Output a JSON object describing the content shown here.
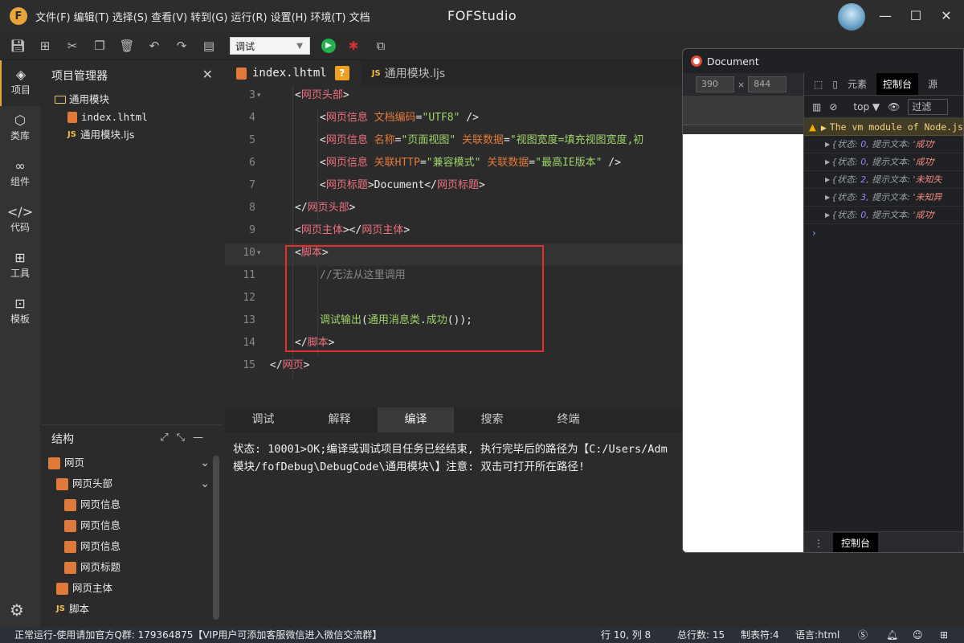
{
  "app": {
    "title": "FOFStudio",
    "logo_letter": "F"
  },
  "menu": [
    "文件(F)",
    "编辑(T)",
    "选择(S)",
    "查看(V)",
    "转到(G)",
    "运行(R)",
    "设置(H)",
    "环境(T)",
    "文档"
  ],
  "toolbar": {
    "mode_value": "调试"
  },
  "activity": [
    {
      "label": "项目",
      "icon": "layers-icon"
    },
    {
      "label": "类库",
      "icon": "cube-icon"
    },
    {
      "label": "组件",
      "icon": "link-icon"
    },
    {
      "label": "代码",
      "icon": "code-icon"
    },
    {
      "label": "工具",
      "icon": "grid-icon"
    },
    {
      "label": "模板",
      "icon": "template-icon"
    }
  ],
  "project": {
    "title": "项目管理器",
    "folder": "通用模块",
    "files": [
      "index.lhtml",
      "通用模块.ljs"
    ]
  },
  "structure": {
    "title": "结构",
    "items": [
      "网页",
      "网页头部",
      "网页信息",
      "网页信息",
      "网页信息",
      "网页标题",
      "网页主体",
      "脚本"
    ]
  },
  "tabs": {
    "active": "index.lhtml",
    "modified_mark": "?",
    "other": "通用模块.ljs",
    "js_badge": "JS"
  },
  "code_lines": [
    {
      "n": "3",
      "parts": [
        [
          "t-txt",
          "<"
        ],
        [
          "t-tag",
          "网页头部"
        ],
        [
          "t-txt",
          ">"
        ]
      ]
    },
    {
      "n": "4",
      "parts": [
        [
          "t-txt",
          "<"
        ],
        [
          "t-tag",
          "网页信息 "
        ],
        [
          "t-attr",
          "文档编码"
        ],
        [
          "t-txt",
          "="
        ],
        [
          "t-str",
          "\"UTF8\""
        ],
        [
          "t-txt",
          " />"
        ]
      ]
    },
    {
      "n": "5",
      "parts": [
        [
          "t-txt",
          "<"
        ],
        [
          "t-tag",
          "网页信息 "
        ],
        [
          "t-attr",
          "名称"
        ],
        [
          "t-txt",
          "="
        ],
        [
          "t-str",
          "\"页面视图\""
        ],
        [
          "t-txt",
          " "
        ],
        [
          "t-attr",
          "关联数据"
        ],
        [
          "t-txt",
          "="
        ],
        [
          "t-str",
          "\"视图宽度=填充视图宽度,初"
        ]
      ]
    },
    {
      "n": "6",
      "parts": [
        [
          "t-txt",
          "<"
        ],
        [
          "t-tag",
          "网页信息 "
        ],
        [
          "t-attr",
          "关联HTTP"
        ],
        [
          "t-txt",
          "="
        ],
        [
          "t-str",
          "\"兼容模式\""
        ],
        [
          "t-txt",
          " "
        ],
        [
          "t-attr",
          "关联数据"
        ],
        [
          "t-txt",
          "="
        ],
        [
          "t-str",
          "\"最高IE版本\""
        ],
        [
          "t-txt",
          " />"
        ]
      ]
    },
    {
      "n": "7",
      "parts": [
        [
          "t-txt",
          "<"
        ],
        [
          "t-tag",
          "网页标题"
        ],
        [
          "t-txt",
          ">Document</"
        ],
        [
          "t-tag",
          "网页标题"
        ],
        [
          "t-txt",
          ">"
        ]
      ]
    },
    {
      "n": "8",
      "parts": [
        [
          "t-txt",
          "</"
        ],
        [
          "t-tag",
          "网页头部"
        ],
        [
          "t-txt",
          ">"
        ]
      ]
    },
    {
      "n": "9",
      "parts": [
        [
          "t-txt",
          "<"
        ],
        [
          "t-tag",
          "网页主体"
        ],
        [
          "t-txt",
          "></"
        ],
        [
          "t-tag",
          "网页主体"
        ],
        [
          "t-txt",
          ">"
        ]
      ]
    },
    {
      "n": "10",
      "parts": [
        [
          "t-txt",
          "<"
        ],
        [
          "t-tag",
          "脚本"
        ],
        [
          "t-txt",
          ">"
        ]
      ]
    },
    {
      "n": "11",
      "parts": [
        [
          "t-cmt",
          "//无法从这里调用"
        ]
      ]
    },
    {
      "n": "12",
      "parts": []
    },
    {
      "n": "13",
      "parts": [
        [
          "t-fn",
          "调试输出"
        ],
        [
          "t-txt",
          "("
        ],
        [
          "t-fn",
          "通用消息类"
        ],
        [
          "t-txt",
          "."
        ],
        [
          "t-fn",
          "成功"
        ],
        [
          "t-txt",
          "());"
        ]
      ]
    },
    {
      "n": "14",
      "parts": [
        [
          "t-txt",
          "</"
        ],
        [
          "t-tag",
          "脚本"
        ],
        [
          "t-txt",
          ">"
        ]
      ]
    },
    {
      "n": "15",
      "parts": [
        [
          "t-txt",
          "</"
        ],
        [
          "t-tag",
          "网页"
        ],
        [
          "t-txt",
          ">"
        ]
      ]
    }
  ],
  "bottom_tabs": [
    "调试",
    "解释",
    "编译",
    "搜索",
    "终端"
  ],
  "output": {
    "line1": "状态: 10001>OK;编译或调试项目任务已经结束, 执行完毕后的路径为【C:/Users/Adm",
    "line2": "模块/fofDebug\\DebugCode\\通用模块\\】注意: 双击可打开所在路径!"
  },
  "devtools": {
    "window_title": "Document",
    "width": "390",
    "height": "844",
    "tabs": [
      "元素",
      "控制台",
      "源"
    ],
    "context": "top",
    "filter": "过滤",
    "warning": "The vm module of Node.js",
    "logs": [
      {
        "state": "0",
        "text": "'成功'"
      },
      {
        "state": "0",
        "text": "'成功'"
      },
      {
        "state": "2",
        "text": "'未知失"
      },
      {
        "state": "3",
        "text": "'未知异"
      },
      {
        "state": "0",
        "text": "'成功'"
      }
    ],
    "log_key_state": "状态:",
    "log_key_text": "提示文本:",
    "drawer_tab": "控制台"
  },
  "status": {
    "left": "正常运行-使用请加官方Q群: 179364875【VIP用户可添加客服微信进入微信交流群】",
    "position": "行 10, 列 8",
    "total": "总行数: 15",
    "tab": "制表符:4",
    "lang": "语言:html"
  }
}
